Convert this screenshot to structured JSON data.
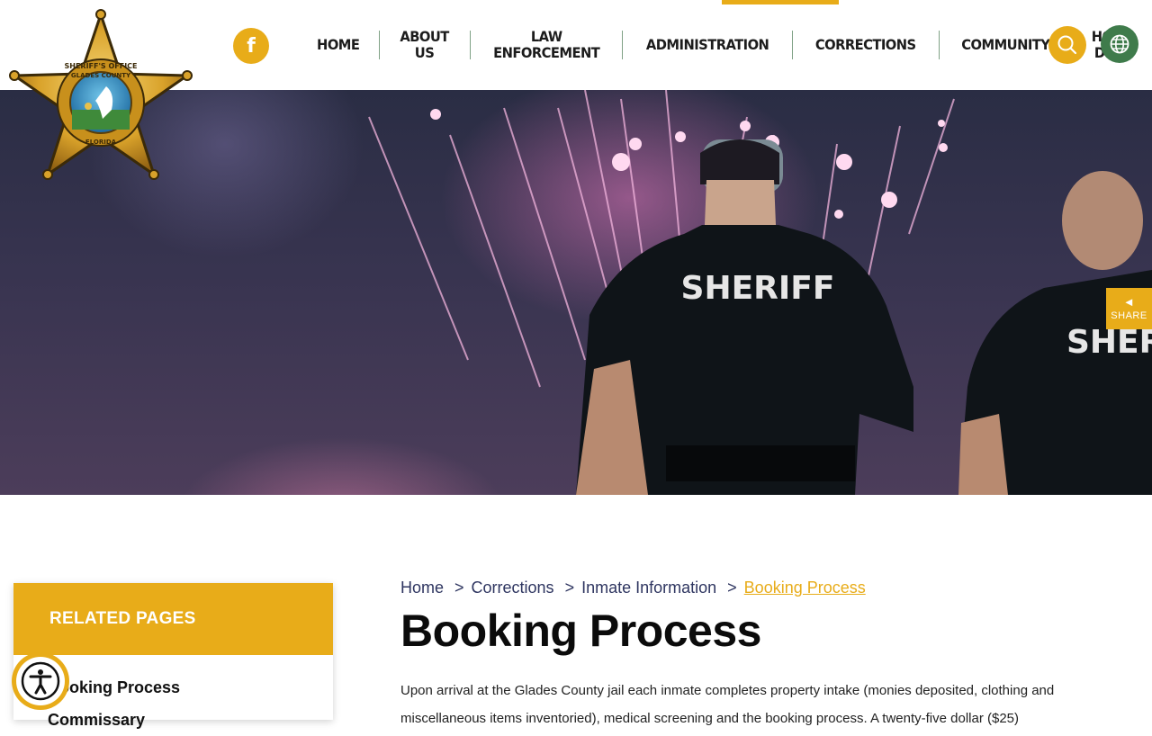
{
  "header": {
    "logo_alt": "Glades County Sheriff's Office, Florida",
    "logo_text_top": "SHERIFF'S OFFICE",
    "logo_text_county": "GLADES COUNTY",
    "logo_text_bottom": "FLORIDA",
    "facebook_label": "f",
    "nav": [
      {
        "line1": "HOME",
        "line2": ""
      },
      {
        "line1": "ABOUT",
        "line2": "US"
      },
      {
        "line1": "LAW",
        "line2": "ENFORCEMENT"
      },
      {
        "line1": "ADMINISTRATION",
        "line2": ""
      },
      {
        "line1": "CORRECTIONS",
        "line2": ""
      },
      {
        "line1": "COMMUNITY",
        "line2": ""
      },
      {
        "line1": "HOW",
        "line2": "DO I"
      }
    ],
    "active_nav": "CORRECTIONS"
  },
  "hero": {
    "vest_text": "SHERIFF",
    "vest_text_partial": "SHERIF"
  },
  "share": {
    "label": "SHARE"
  },
  "sidebar": {
    "heading": "RELATED PAGES",
    "items": [
      "Booking Process",
      "Commissary"
    ]
  },
  "breadcrumb": {
    "items": [
      "Home",
      "Corrections",
      "Inmate Information"
    ],
    "separator": ">",
    "current": "Booking Process"
  },
  "page": {
    "title": "Booking Process",
    "body": "Upon arrival at the Glades County jail each inmate completes property intake (monies deposited, clothing and miscellaneous items inventoried), medical screening and the booking process. A twenty-five dollar ($25)"
  },
  "colors": {
    "accent": "#e8ac19",
    "green": "#3f7b4b",
    "link": "#2e3560",
    "nav_text": "#1c1c1c"
  }
}
